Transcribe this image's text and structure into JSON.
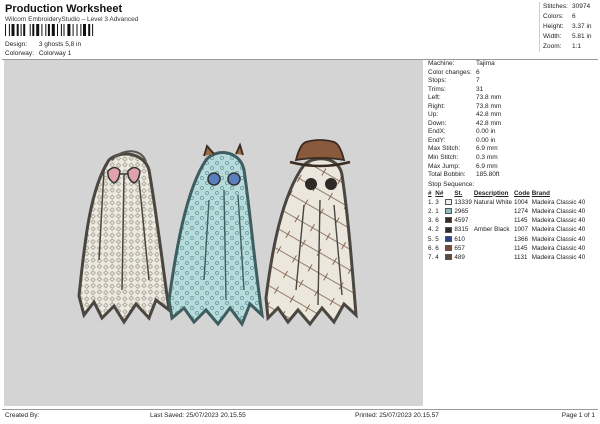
{
  "header": {
    "title": "Production Worksheet",
    "subtitle": "Wilcom EmbroideryStudio – Level 3 Advanced",
    "design_label": "Design:",
    "design_value": "3 ghosts 5,8 in",
    "colorway_label": "Colorway:",
    "colorway_value": "Colorway 1"
  },
  "stats": [
    {
      "label": "Stitches:",
      "value": "30974"
    },
    {
      "label": "Colors:",
      "value": "6"
    },
    {
      "label": "Height:",
      "value": "3.37 in"
    },
    {
      "label": "Width:",
      "value": "5.81 in"
    },
    {
      "label": "Zoom:",
      "value": "1:1"
    }
  ],
  "info": [
    {
      "label": "Machine:",
      "value": "Tajima"
    },
    {
      "label": "Color changes:",
      "value": "6"
    },
    {
      "label": "Stops:",
      "value": "7"
    },
    {
      "label": "Trims:",
      "value": "31"
    },
    {
      "label": "Left:",
      "value": "73.8 mm"
    },
    {
      "label": "Right:",
      "value": "73.8 mm"
    },
    {
      "label": "Up:",
      "value": "42.8 mm"
    },
    {
      "label": "Down:",
      "value": "42.8 mm"
    },
    {
      "label": "EndX:",
      "value": "0.00 in"
    },
    {
      "label": "EndY:",
      "value": "0.00 in"
    },
    {
      "label": "Max Stitch:",
      "value": "6.9 mm"
    },
    {
      "label": "Min Stitch:",
      "value": "0.3 mm"
    },
    {
      "label": "Max Jump:",
      "value": "6.9 mm"
    },
    {
      "label": "Total Bobbin:",
      "value": "185.80ft"
    }
  ],
  "sequence": {
    "title": "Stop Sequence:",
    "headers": [
      "#",
      "N#",
      "",
      "St.",
      "Description",
      "Code",
      "Brand"
    ],
    "rows": [
      {
        "num": "1.",
        "n": "3",
        "color": "#efefe6",
        "st": "13339",
        "desc": "Natural White",
        "code": "1004",
        "brand": "Madeira Classic 40"
      },
      {
        "num": "2.",
        "n": "1",
        "color": "#8cc0c4",
        "st": "2965",
        "desc": "",
        "code": "1274",
        "brand": "Madeira Classic 40"
      },
      {
        "num": "3.",
        "n": "6",
        "color": "#3a2b22",
        "st": "4597",
        "desc": "",
        "code": "1145",
        "brand": "Madeira Classic 40"
      },
      {
        "num": "4.",
        "n": "2",
        "color": "#2f2a26",
        "st": "8315",
        "desc": "Amber Black",
        "code": "1007",
        "brand": "Madeira Classic 40"
      },
      {
        "num": "5.",
        "n": "5",
        "color": "#2d3f8f",
        "st": "610",
        "desc": "",
        "code": "1366",
        "brand": "Madeira Classic 40"
      },
      {
        "num": "6.",
        "n": "6",
        "color": "#7c4a3c",
        "st": "657",
        "desc": "",
        "code": "1145",
        "brand": "Madeira Classic 40"
      },
      {
        "num": "7.",
        "n": "4",
        "color": "#5a4a40",
        "st": "489",
        "desc": "",
        "code": "1131",
        "brand": "Madeira Classic 40"
      }
    ]
  },
  "footer": {
    "created_by": "Created By:",
    "last_saved": "Last Saved: 25/07/2023 20.15.55",
    "printed": "Printed: 25/07/2023 20.15.57",
    "page": "Page 1 of 1"
  }
}
